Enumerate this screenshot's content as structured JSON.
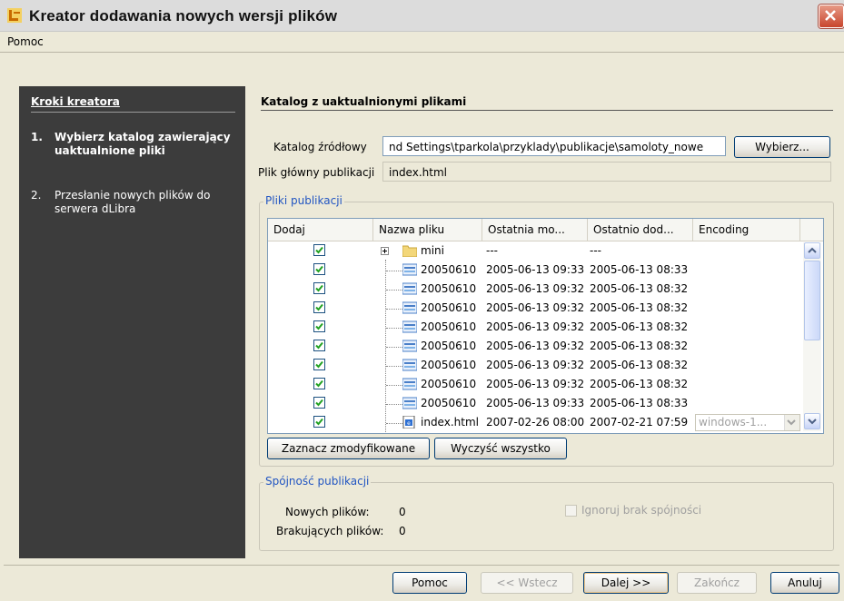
{
  "window": {
    "title": "Kreator dodawania nowych wersji plików"
  },
  "menu": {
    "items": [
      {
        "label": "Pomoc"
      }
    ]
  },
  "sidebar": {
    "title": "Kroki kreatora",
    "steps": [
      {
        "num": "1.",
        "label": "Wybierz katalog zawierający uaktualnione pliki",
        "active": true
      },
      {
        "num": "2.",
        "label": "Przesłanie nowych plików do serwera dLibra",
        "active": false
      }
    ]
  },
  "main": {
    "title": "Katalog z uaktualnionymi plikami",
    "source_dir_label": "Katalog źródłowy",
    "source_dir_value": "nd Settings\\tparkola\\przyklady\\publikacje\\samoloty_nowe",
    "browse_button": "Wybierz...",
    "main_file_label": "Plik główny publikacji",
    "main_file_value": "index.html"
  },
  "files_group": {
    "label": "Pliki publikacji",
    "columns": [
      "Dodaj",
      "Nazwa pliku",
      "Ostatnia mo...",
      "Ostatnio dod...",
      "Encoding"
    ],
    "rows": [
      {
        "checked": true,
        "type": "folder",
        "name": "mini",
        "modified": "---",
        "added": "---",
        "encoding": ""
      },
      {
        "checked": true,
        "type": "image",
        "name": "20050610",
        "modified": "2005-06-13 09:33",
        "added": "2005-06-13 08:33",
        "encoding": ""
      },
      {
        "checked": true,
        "type": "image",
        "name": "20050610",
        "modified": "2005-06-13 09:32",
        "added": "2005-06-13 08:32",
        "encoding": ""
      },
      {
        "checked": true,
        "type": "image",
        "name": "20050610",
        "modified": "2005-06-13 09:32",
        "added": "2005-06-13 08:32",
        "encoding": ""
      },
      {
        "checked": true,
        "type": "image",
        "name": "20050610",
        "modified": "2005-06-13 09:32",
        "added": "2005-06-13 08:32",
        "encoding": ""
      },
      {
        "checked": true,
        "type": "image",
        "name": "20050610",
        "modified": "2005-06-13 09:32",
        "added": "2005-06-13 08:32",
        "encoding": ""
      },
      {
        "checked": true,
        "type": "image",
        "name": "20050610",
        "modified": "2005-06-13 09:32",
        "added": "2005-06-13 08:32",
        "encoding": ""
      },
      {
        "checked": true,
        "type": "image",
        "name": "20050610",
        "modified": "2005-06-13 09:32",
        "added": "2005-06-13 08:32",
        "encoding": ""
      },
      {
        "checked": true,
        "type": "image",
        "name": "20050610",
        "modified": "2005-06-13 09:33",
        "added": "2005-06-13 08:33",
        "encoding": ""
      },
      {
        "checked": true,
        "type": "html",
        "name": "index.html",
        "modified": "2007-02-26 08:00",
        "added": "2007-02-21 07:59",
        "encoding": "windows-1..."
      }
    ],
    "select_modified_button": "Zaznacz zmodyfikowane",
    "clear_all_button": "Wyczyść wszystko"
  },
  "consistency_group": {
    "label": "Spójność publikacji",
    "new_files_label": "Nowych plików:",
    "new_files_value": "0",
    "missing_files_label": "Brakujących plików:",
    "missing_files_value": "0",
    "ignore_label": "Ignoruj brak spójności"
  },
  "footer": {
    "help": "Pomoc",
    "back": "<< Wstecz",
    "next": "Dalej >>",
    "finish": "Zakończ",
    "cancel": "Anuluj"
  },
  "colors": {
    "sidebar_bg": "#3c3c3c",
    "group_label": "#2155c2",
    "check": "#21a121"
  }
}
